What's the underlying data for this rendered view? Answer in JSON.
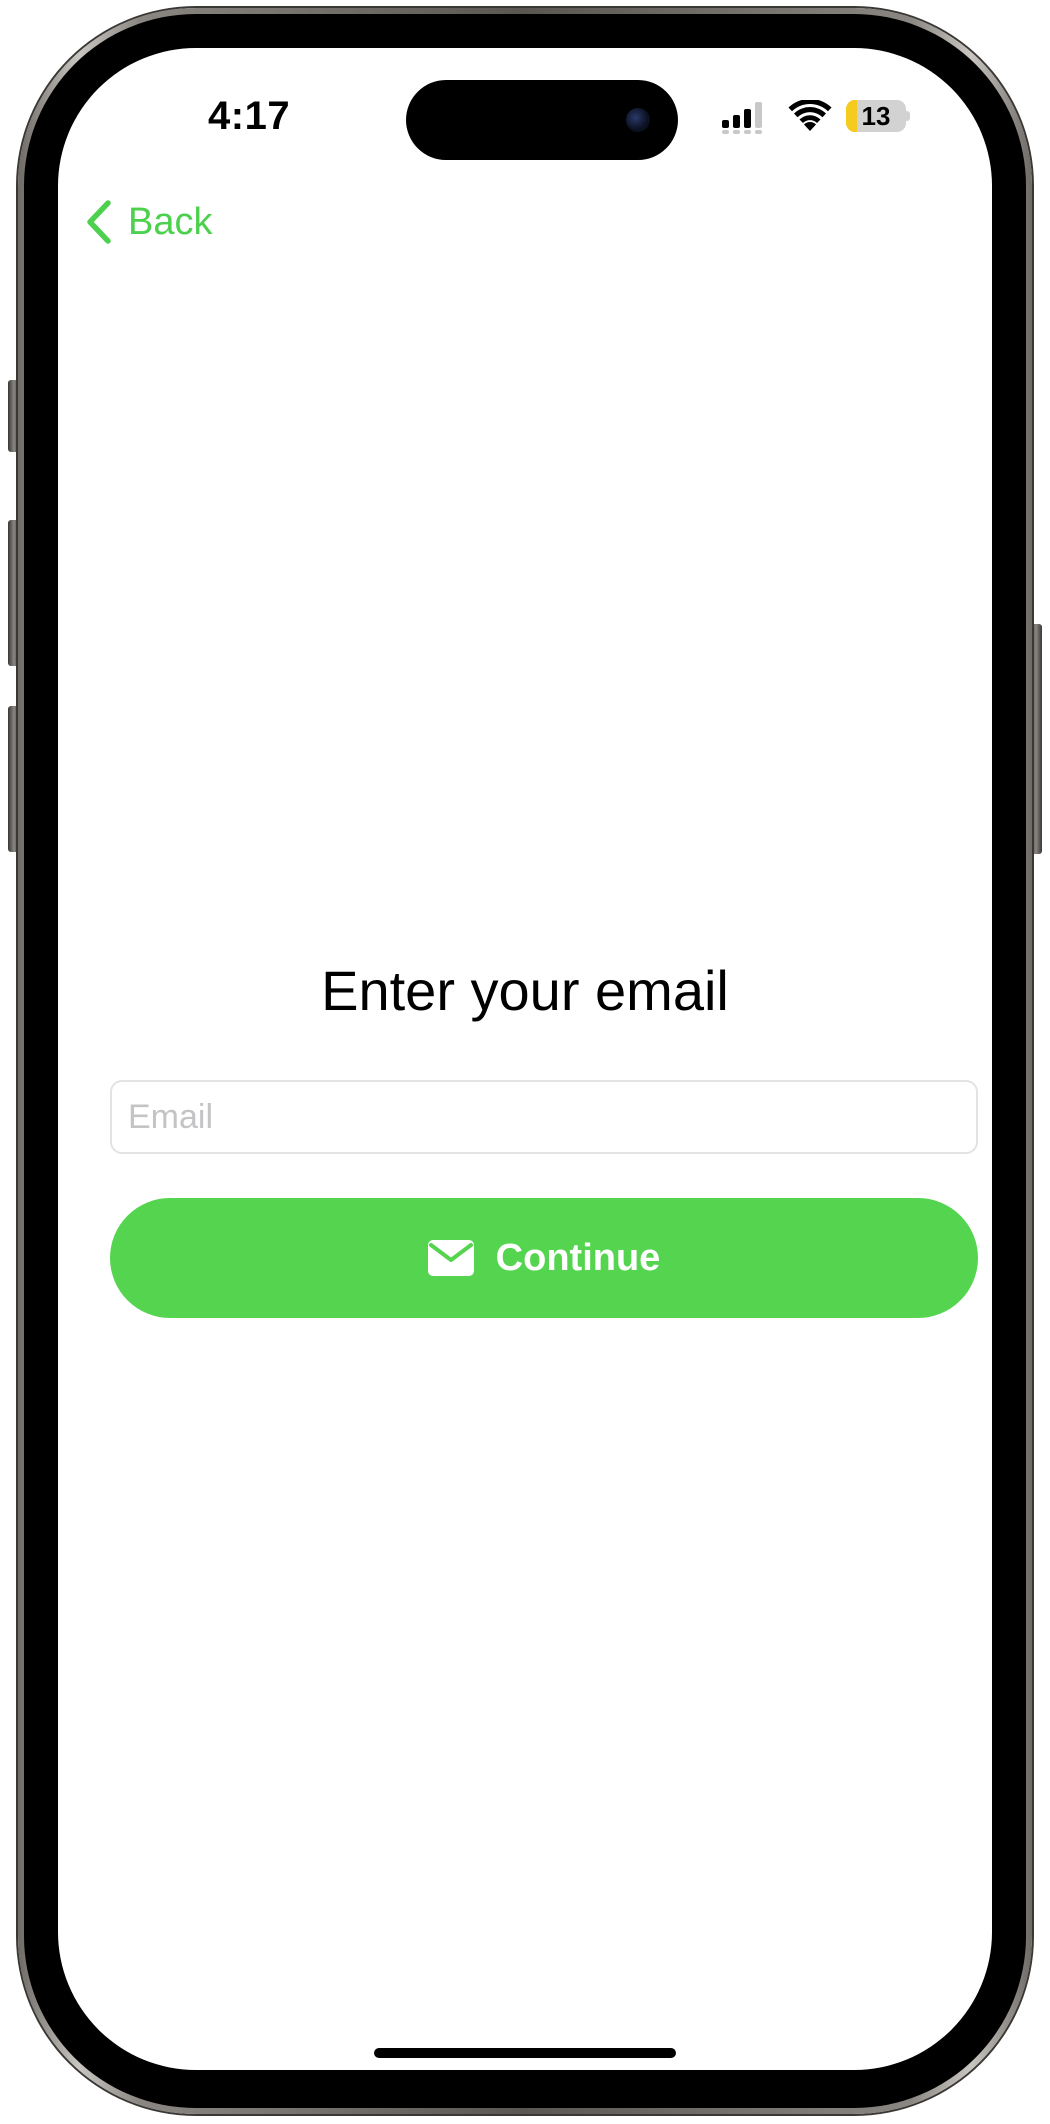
{
  "status_bar": {
    "time": "4:17",
    "battery_level": "13",
    "battery_fraction": 0.13,
    "icons": [
      "signal-icon",
      "wifi-icon",
      "battery-icon"
    ]
  },
  "nav": {
    "back_label": "Back",
    "back_icon": "chevron-left-icon"
  },
  "main": {
    "title": "Enter your email",
    "email_placeholder": "Email",
    "email_value": "",
    "continue_label": "Continue",
    "continue_icon": "envelope-icon"
  },
  "colors": {
    "accent": "#55d54f",
    "back_text": "#4cd04e",
    "placeholder": "#c4c4c6",
    "field_border": "#e3e3e3",
    "battery_low": "#f5cb1e"
  }
}
